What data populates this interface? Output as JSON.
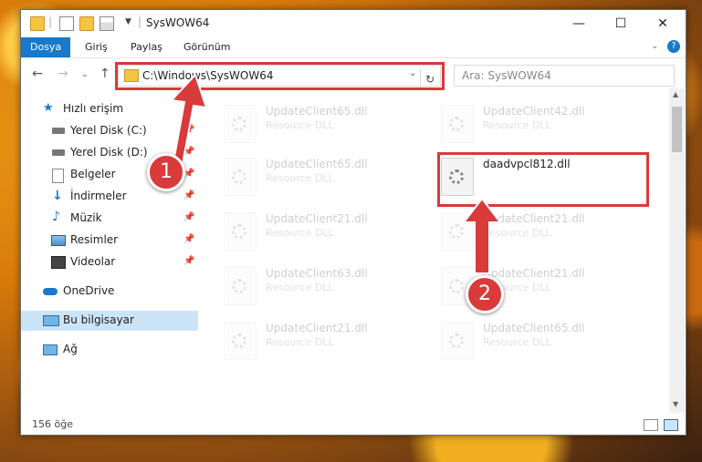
{
  "window": {
    "title": "SysWOW64",
    "controls": {
      "minimize": "—",
      "maximize": "☐",
      "close": "✕"
    }
  },
  "ribbon": {
    "tabs": [
      {
        "label": "Dosya",
        "active": true
      },
      {
        "label": "Giriş"
      },
      {
        "label": "Paylaş"
      },
      {
        "label": "Görünüm"
      }
    ],
    "expand_icon": "chevron-down-icon",
    "help_icon": "help-icon"
  },
  "address": {
    "path": "C:\\Windows\\SysWOW64",
    "search_placeholder": "Ara: SysWOW64"
  },
  "sidebar": {
    "items": [
      {
        "label": "Hızlı erişim",
        "icon": "star-icon"
      },
      {
        "label": "Yerel Disk (C:)",
        "icon": "drive-icon",
        "pinned": true
      },
      {
        "label": "Yerel Disk (D:)",
        "icon": "drive-icon",
        "pinned": true
      },
      {
        "label": "Belgeler",
        "icon": "documents-icon",
        "pinned": true
      },
      {
        "label": "İndirmeler",
        "icon": "download-icon",
        "pinned": true
      },
      {
        "label": "Müzik",
        "icon": "music-icon",
        "pinned": true
      },
      {
        "label": "Resimler",
        "icon": "pictures-icon",
        "pinned": true
      },
      {
        "label": "Videolar",
        "icon": "videos-icon",
        "pinned": true
      },
      {
        "label": "OneDrive",
        "icon": "cloud-icon"
      },
      {
        "label": "Bu bilgisayar",
        "icon": "computer-icon",
        "selected": true
      },
      {
        "label": "Ağ",
        "icon": "network-icon"
      }
    ]
  },
  "files": [
    {
      "name": "UpdateClient65.dll",
      "type": "Resource DLL",
      "faded": true
    },
    {
      "name": "UpdateClient42.dll",
      "type": "Resource DLL",
      "faded": true
    },
    {
      "name": "UpdateClient65.dll",
      "type": "Resource DLL",
      "faded": true
    },
    {
      "name": "daadvpcl812.dll",
      "type": "",
      "faded": false
    },
    {
      "name": "UpdateClient21.dll",
      "type": "Resource DLL",
      "faded": true
    },
    {
      "name": "UpdateClient21.dll",
      "type": "Resource DLL",
      "faded": true
    },
    {
      "name": "UpdateClient63.dll",
      "type": "Resource DLL",
      "faded": true
    },
    {
      "name": "UpdateClient21.dll",
      "type": "Resource DLL",
      "faded": true
    },
    {
      "name": "UpdateClient21.dll",
      "type": "Resource DLL",
      "faded": true
    },
    {
      "name": "UpdateClient65.dll",
      "type": "Resource DLL",
      "faded": true
    }
  ],
  "status": {
    "count": "156 öğe"
  },
  "annotations": {
    "badge1": "1",
    "badge2": "2",
    "color": "#d93a3a"
  }
}
